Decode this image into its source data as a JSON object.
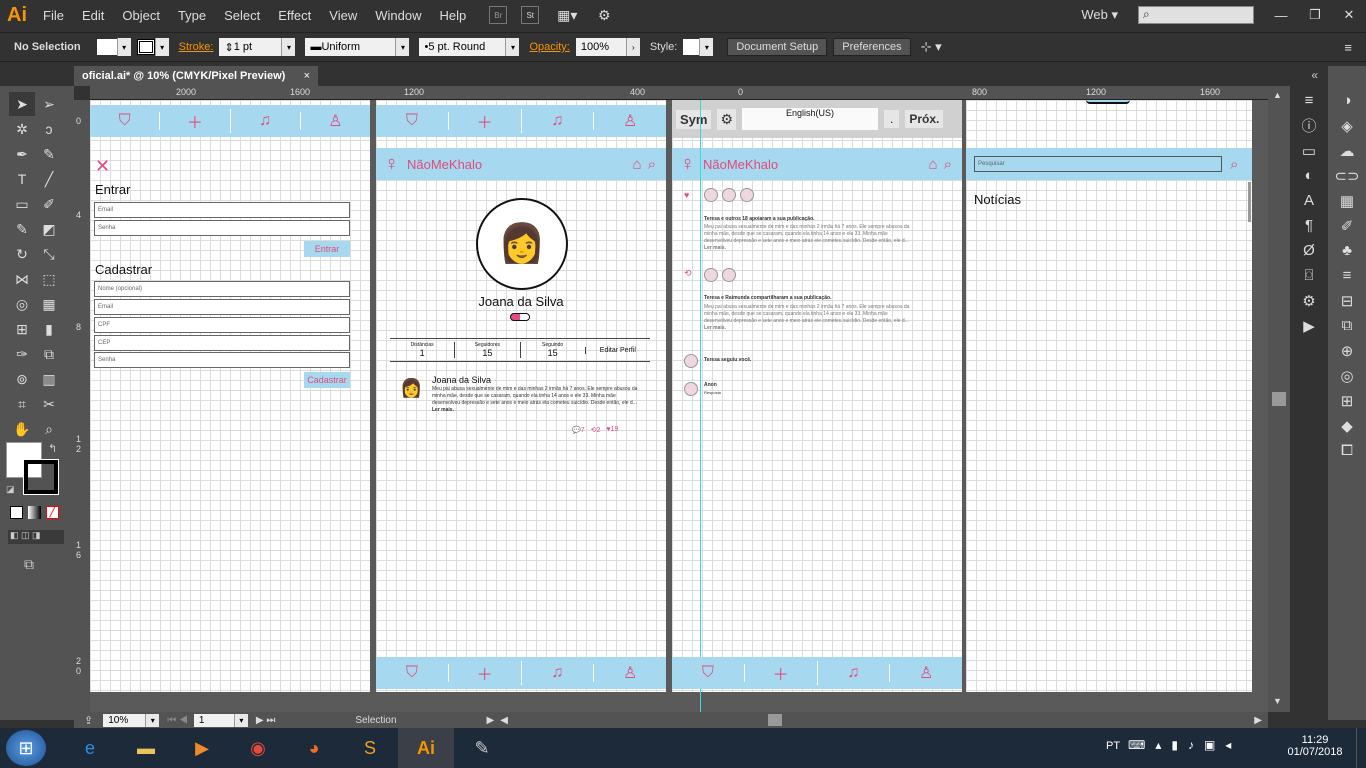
{
  "menubar": {
    "logo": "Ai",
    "items": [
      "File",
      "Edit",
      "Object",
      "Type",
      "Select",
      "Effect",
      "View",
      "Window",
      "Help"
    ],
    "br_label": "Br",
    "st_label": "St",
    "workspace": "Web"
  },
  "control": {
    "selection": "No Selection",
    "stroke_label": "Stroke:",
    "stroke_value": "1 pt",
    "uniform": "Uniform",
    "brush": "5 pt. Round",
    "opacity_label": "Opacity:",
    "opacity_value": "100%",
    "style_label": "Style:",
    "doc_setup": "Document Setup",
    "preferences": "Preferences"
  },
  "tab": {
    "title": "oficial.ai* @ 10% (CMYK/Pixel Preview)",
    "close": "×"
  },
  "ruler": {
    "h": [
      "2000",
      "1600",
      "1200",
      "800",
      "400",
      "0",
      "800",
      "1200",
      "1600"
    ],
    "v": [
      "0",
      "4",
      "8",
      "1 2",
      "1 6",
      "2 0"
    ]
  },
  "login": {
    "entrar_title": "Entrar",
    "email": "Email",
    "senha": "Senha",
    "entrar_btn": "Entrar",
    "cadastrar_title": "Cadastrar",
    "nome": "Nome (opcional)",
    "email2": "Email",
    "cpf": "CPF",
    "cep": "CEP",
    "senha2": "Senha",
    "cadastrar_btn": "Cadastrar"
  },
  "app": {
    "brand": "NãoMeKhalo"
  },
  "profile": {
    "name": "Joana da Silva",
    "stats": [
      {
        "label": "Distâncias",
        "value": "1"
      },
      {
        "label": "Seguidores",
        "value": "15"
      },
      {
        "label": "Seguindo",
        "value": "15"
      }
    ],
    "edit": "Editar Perfil",
    "post_author": "Joana da Silva",
    "post_text": "Meu pai abusa sexualmente de mim e das minhas 2 irmãs há 7 anos. Ele sempre abusou da minha mãe, desde que se casaram, quando ela tinha 14 anos e ele 33. Minha mãe desenvolveu depressão e sete anos e meio atrás ela cometeu suicídio. Desde então, ele d...",
    "more": "Ler mais.",
    "comments": "7",
    "shares": "2",
    "likes": "19"
  },
  "notifications": {
    "n1": "Teresa e outros 18 apoiaram a sua publicação.",
    "n1_text": "Meu pai abusa sexualmente de mim e das minhas 2 irmãs há 7 anos. Ele sempre abusou da minha mãe, desde que se casaram, quando ela tinha 14 anos e ele 33. Minha mãe desenvolveu depressão e sete anos e meio atrás ele cometeu suicídio. Desde então, ele d...",
    "more": "Ler mais.",
    "n2": "Teresa e Raimunda compartilharam a sua publicação.",
    "n2_text": "Meu pai abusa sexualmente de mim e das minhas 2 irmãs há 7 anos. Ele sempre abusou da minha mãe, desde que se casaram, quando ela tinha 14 anos e ele 33. Minha mãe desenvolveu depressão e sete anos e meio atrás ele cometeu suicídio. Desde então, ele d...",
    "n3": "Teresa seguiu você.",
    "n4": "Anon",
    "n4_sub": "Resposta"
  },
  "keyboard": {
    "sym": "Sym",
    "lang": "English(US)",
    "dot": ".",
    "next": "Próx."
  },
  "news": {
    "search": "Pesquisar",
    "title": "Notícias"
  },
  "status": {
    "zoom": "10%",
    "page": "1",
    "tool": "Selection"
  },
  "taskbar": {
    "lang": "PT",
    "time": "11:29",
    "date": "01/07/2018"
  }
}
